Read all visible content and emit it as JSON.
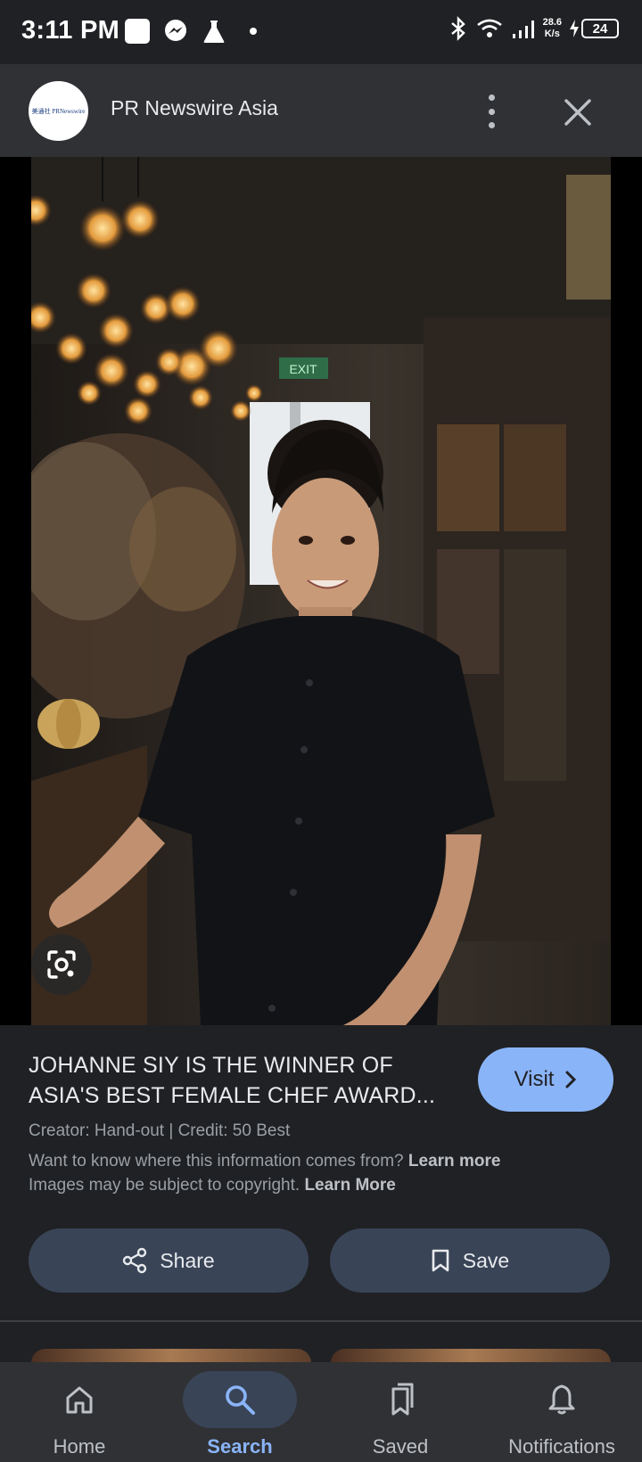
{
  "status_bar": {
    "time": "3:11 PM",
    "net_speed_value": "28.6",
    "net_speed_unit": "K/s",
    "battery": "24"
  },
  "header": {
    "source_name": "PR Newswire Asia",
    "logo_text": "美通社 PRNewswire"
  },
  "image_result": {
    "title": "JOHANNE SIY IS THE WINNER OF ASIA'S BEST FEMALE CHEF AWARD...",
    "visit_label": "Visit",
    "credit": "Creator: Hand-out | Credit: 50 Best",
    "info_prefix": "Want to know where this information comes from?",
    "info_link": "Learn more",
    "copyright_prefix": "Images may be subject to copyright.",
    "copyright_link": "Learn More",
    "share_label": "Share",
    "save_label": "Save",
    "photo_sign": "EXIT"
  },
  "bottom_nav": {
    "items": [
      {
        "label": "Home",
        "icon": "home-icon",
        "active": false
      },
      {
        "label": "Search",
        "icon": "search-icon",
        "active": true
      },
      {
        "label": "Saved",
        "icon": "bookmarks-icon",
        "active": false
      },
      {
        "label": "Notifications",
        "icon": "bell-icon",
        "active": false
      }
    ]
  },
  "colors": {
    "accent": "#8ab4f8",
    "background": "#202124",
    "surface": "#303134",
    "button": "#394457"
  }
}
